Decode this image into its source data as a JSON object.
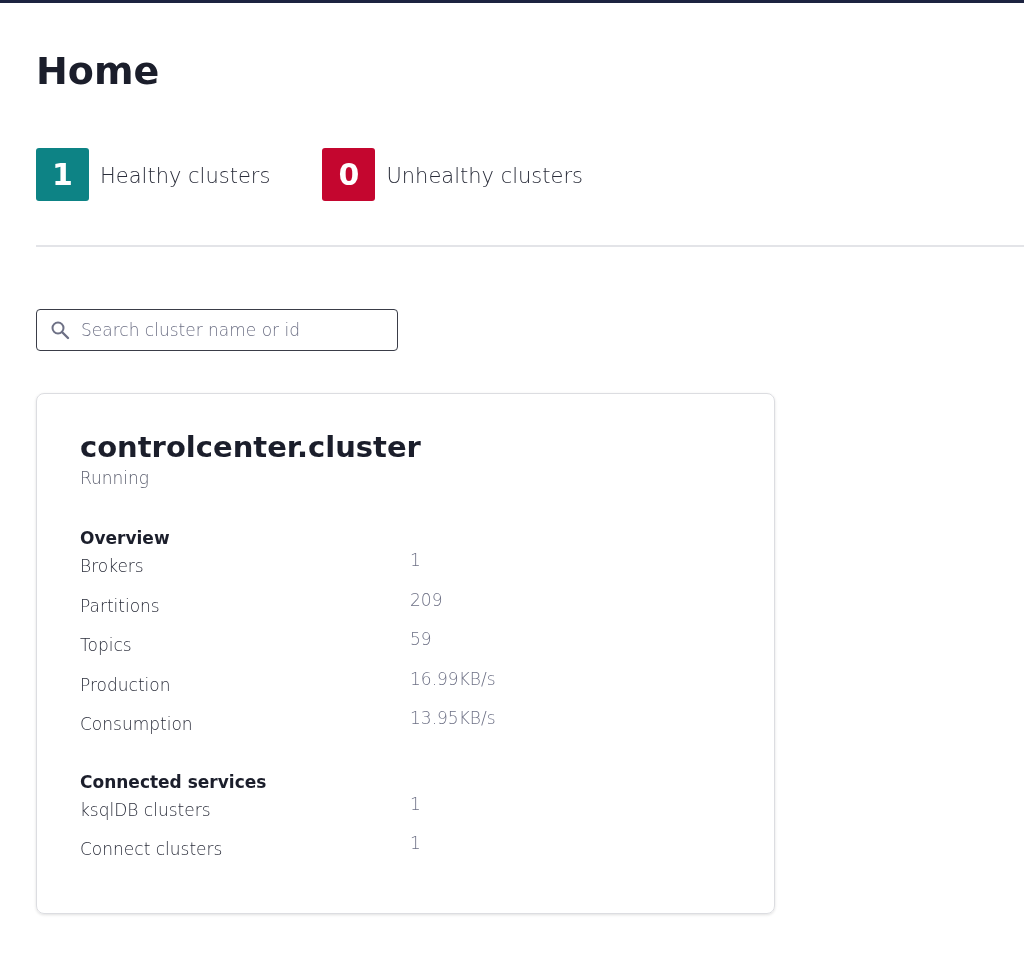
{
  "page": {
    "title": "Home"
  },
  "summary": [
    {
      "count": "1",
      "label": "Healthy clusters",
      "color": "#0d8385"
    },
    {
      "count": "0",
      "label": "Unhealthy clusters",
      "color": "#c4062f"
    }
  ],
  "search": {
    "placeholder": "Search cluster name or id"
  },
  "cluster": {
    "name": "controlcenter.cluster",
    "status": "Running",
    "sections": [
      {
        "heading": "Overview",
        "rows": [
          {
            "label": "Brokers",
            "value": "1"
          },
          {
            "label": "Partitions",
            "value": "209"
          },
          {
            "label": "Topics",
            "value": "59"
          },
          {
            "label": "Production",
            "value": "16.99KB/s"
          },
          {
            "label": "Consumption",
            "value": "13.95KB/s"
          }
        ]
      },
      {
        "heading": "Connected services",
        "rows": [
          {
            "label": "ksqlDB clusters",
            "value": "1"
          },
          {
            "label": "Connect clusters",
            "value": "1"
          }
        ]
      }
    ]
  }
}
